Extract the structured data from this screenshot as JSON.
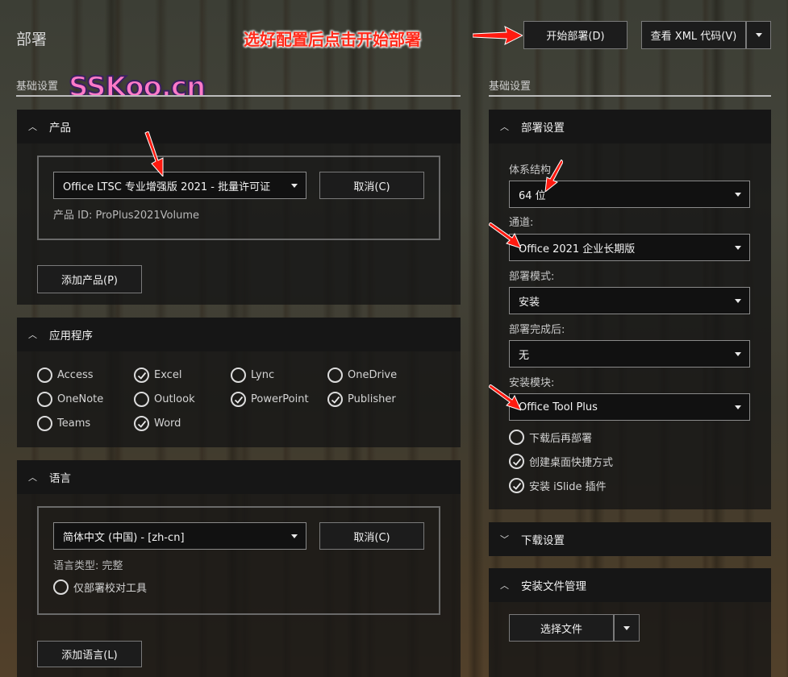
{
  "page": {
    "title": "部署"
  },
  "annotation": {
    "text": "选好配置后点击开始部署"
  },
  "top_buttons": {
    "start": "开始部署(D)",
    "view_xml": "查看 XML 代码(V)"
  },
  "watermark": {
    "text": "SSKoo.cn"
  },
  "left": {
    "section_label": "基础设置",
    "product": {
      "header": "产品",
      "select_value": "Office LTSC 专业增强版 2021 - 批量许可证",
      "cancel": "取消(C)",
      "product_id": "产品 ID: ProPlus2021Volume",
      "add": "添加产品(P)"
    },
    "apps": {
      "header": "应用程序",
      "items": [
        {
          "label": "Access",
          "checked": false
        },
        {
          "label": "Excel",
          "checked": true
        },
        {
          "label": "Lync",
          "checked": false
        },
        {
          "label": "OneDrive",
          "checked": false
        },
        {
          "label": "OneNote",
          "checked": false
        },
        {
          "label": "Outlook",
          "checked": false
        },
        {
          "label": "PowerPoint",
          "checked": true
        },
        {
          "label": "Publisher",
          "checked": true
        },
        {
          "label": "Teams",
          "checked": false
        },
        {
          "label": "Word",
          "checked": true
        }
      ]
    },
    "language": {
      "header": "语言",
      "select_value": "简体中文 (中国) - [zh-cn]",
      "cancel": "取消(C)",
      "type": "语言类型: 完整",
      "proofing_only": "仅部署校对工具",
      "add": "添加语言(L)"
    }
  },
  "right": {
    "section_label": "基础设置",
    "deploy": {
      "header": "部署设置",
      "arch_label": "体系结构",
      "arch_value": "64 位",
      "channel_label": "通道:",
      "channel_value": "Office 2021 企业长期版",
      "mode_label": "部署模式:",
      "mode_value": "安装",
      "after_label": "部署完成后:",
      "after_value": "无",
      "module_label": "安装模块:",
      "module_value": "Office Tool Plus",
      "options": [
        {
          "label": "下载后再部署",
          "checked": false
        },
        {
          "label": "创建桌面快捷方式",
          "checked": true
        },
        {
          "label": "安装 iSlide 插件",
          "checked": true
        }
      ]
    },
    "download": {
      "header": "下载设置"
    },
    "files": {
      "header": "安装文件管理",
      "choose": "选择文件"
    }
  },
  "icons": [
    "chevron-up-icon",
    "chevron-down-icon",
    "check-icon",
    "caret-down-icon",
    "arrow-icon"
  ]
}
